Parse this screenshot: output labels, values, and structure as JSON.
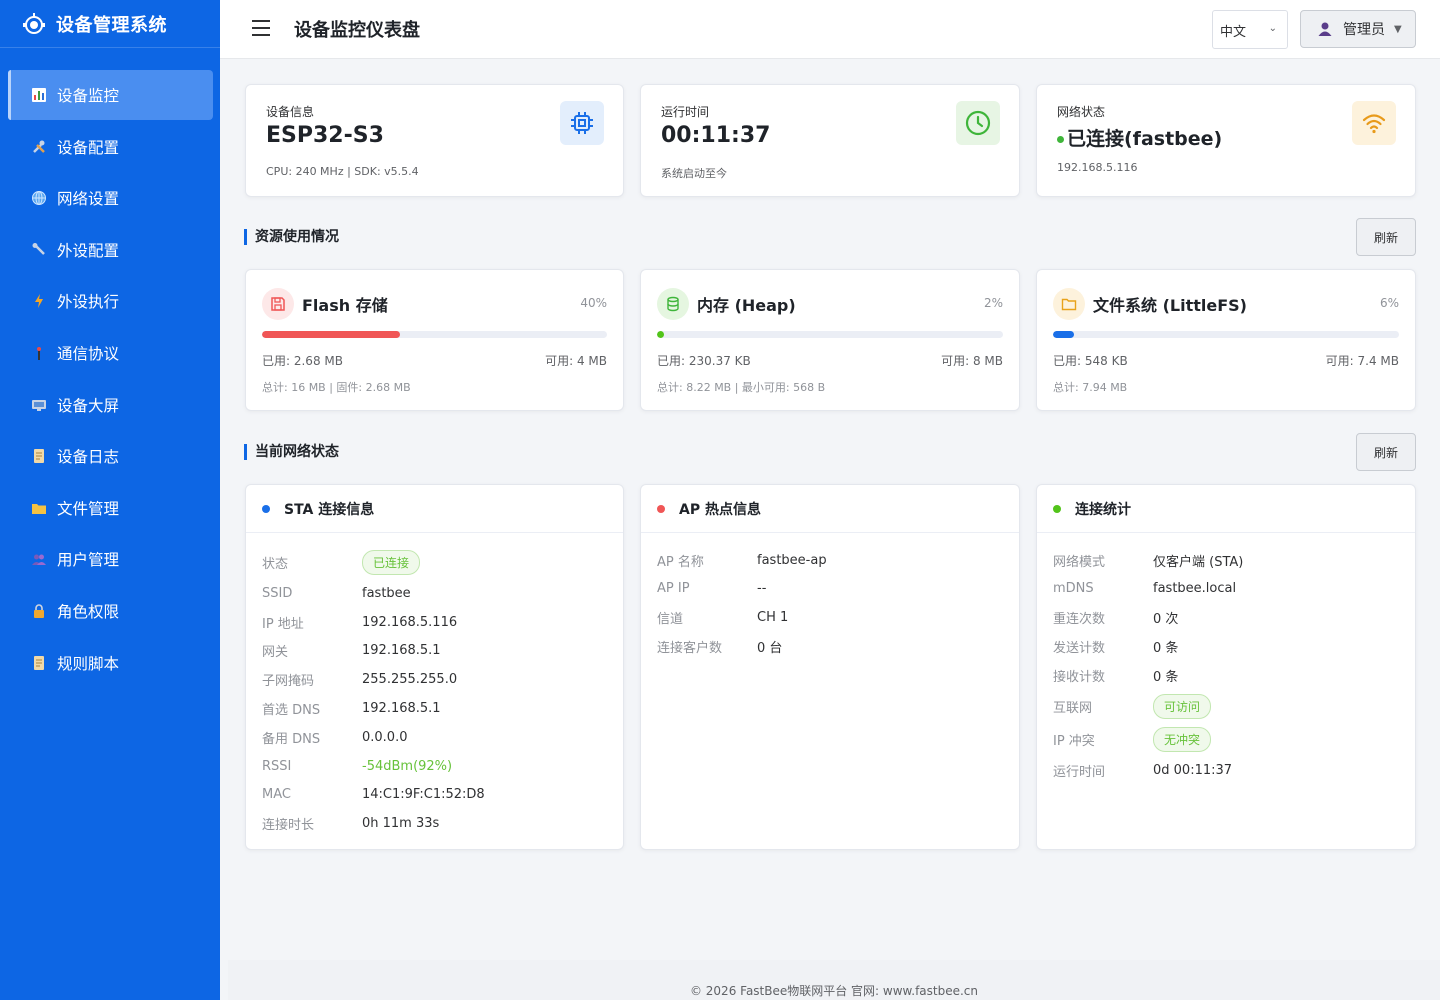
{
  "sidebar": {
    "brand": "设备管理系统",
    "items": [
      {
        "label": "设备监控",
        "icon": "bar-chart-icon",
        "active": true
      },
      {
        "label": "设备配置",
        "icon": "tools-icon"
      },
      {
        "label": "网络设置",
        "icon": "globe-icon"
      },
      {
        "label": "外设配置",
        "icon": "wrench-icon"
      },
      {
        "label": "外设执行",
        "icon": "lightning-icon"
      },
      {
        "label": "通信协议",
        "icon": "antenna-icon"
      },
      {
        "label": "设备大屏",
        "icon": "monitor-icon"
      },
      {
        "label": "设备日志",
        "icon": "scroll-icon"
      },
      {
        "label": "文件管理",
        "icon": "folder-icon"
      },
      {
        "label": "用户管理",
        "icon": "users-icon"
      },
      {
        "label": "角色权限",
        "icon": "lock-icon"
      },
      {
        "label": "规则脚本",
        "icon": "scroll-icon"
      }
    ]
  },
  "header": {
    "title": "设备监控仪表盘",
    "language": "中文",
    "user": "管理员"
  },
  "info_cards": {
    "device": {
      "label": "设备信息",
      "value": "ESP32-S3",
      "sub": "CPU: 240 MHz | SDK: v5.5.4",
      "icon": "cpu-chip-icon"
    },
    "uptime": {
      "label": "运行时间",
      "value": "00:11:37",
      "sub": "系统启动至今",
      "icon": "clock-icon"
    },
    "network": {
      "label": "网络状态",
      "value": "已连接(fastbee)",
      "sub": "192.168.5.116",
      "icon": "wifi-icon"
    }
  },
  "resources": {
    "title": "资源使用情况",
    "refresh": "刷新",
    "flash": {
      "title": "Flash 存储",
      "percent": 40,
      "percent_label": "40%",
      "used": "已用: 2.68 MB",
      "avail": "可用: 4 MB",
      "total": "总计: 16 MB | 固件: 2.68 MB",
      "color": "#f05656",
      "icon": "floppy-disk-icon"
    },
    "heap": {
      "title": "内存 (Heap)",
      "percent": 2,
      "percent_label": "2%",
      "used": "已用: 230.37 KB",
      "avail": "可用: 8 MB",
      "total": "总计: 8.22 MB | 最小可用: 568 B",
      "color": "#52c41a",
      "icon": "database-icon"
    },
    "fs": {
      "title": "文件系统 (LittleFS)",
      "percent": 6,
      "percent_label": "6%",
      "used": "已用: 548 KB",
      "avail": "可用: 7.4 MB",
      "total": "总计: 7.94 MB",
      "color": "#1a6fe8",
      "icon": "folder-icon"
    }
  },
  "network": {
    "title": "当前网络状态",
    "refresh": "刷新",
    "sta": {
      "title": "STA 连接信息",
      "dot_color": "#1a6fe8",
      "rows": [
        {
          "k": "状态",
          "v": "已连接"
        },
        {
          "k": "SSID",
          "v": "fastbee"
        },
        {
          "k": "IP 地址",
          "v": "192.168.5.116"
        },
        {
          "k": "网关",
          "v": "192.168.5.1"
        },
        {
          "k": "子网掩码",
          "v": "255.255.255.0"
        },
        {
          "k": "首选 DNS",
          "v": "192.168.5.1"
        },
        {
          "k": "备用 DNS",
          "v": "0.0.0.0"
        },
        {
          "k": "RSSI",
          "v": "-54dBm(92%)"
        },
        {
          "k": "MAC",
          "v": "14:C1:9F:C1:52:D8"
        },
        {
          "k": "连接时长",
          "v": "0h 11m 33s"
        }
      ]
    },
    "ap": {
      "title": "AP 热点信息",
      "dot_color": "#f05656",
      "rows": [
        {
          "k": "AP 名称",
          "v": "fastbee-ap"
        },
        {
          "k": "AP IP",
          "v": "--"
        },
        {
          "k": "信道",
          "v": "CH 1"
        },
        {
          "k": "连接客户数",
          "v": "0 台"
        }
      ]
    },
    "stats": {
      "title": "连接统计",
      "dot_color": "#52c41a",
      "rows": [
        {
          "k": "网络模式",
          "v": "仅客户端 (STA)"
        },
        {
          "k": "mDNS",
          "v": "fastbee.local"
        },
        {
          "k": "重连次数",
          "v": "0 次"
        },
        {
          "k": "发送计数",
          "v": "0 条"
        },
        {
          "k": "接收计数",
          "v": "0 条"
        },
        {
          "k": "互联网",
          "v": "可访问"
        },
        {
          "k": "IP 冲突",
          "v": "无冲突"
        },
        {
          "k": "运行时间",
          "v": "0d 00:11:37"
        }
      ]
    }
  },
  "footer": "© 2026 FastBee物联网平台 官网: www.fastbee.cn"
}
